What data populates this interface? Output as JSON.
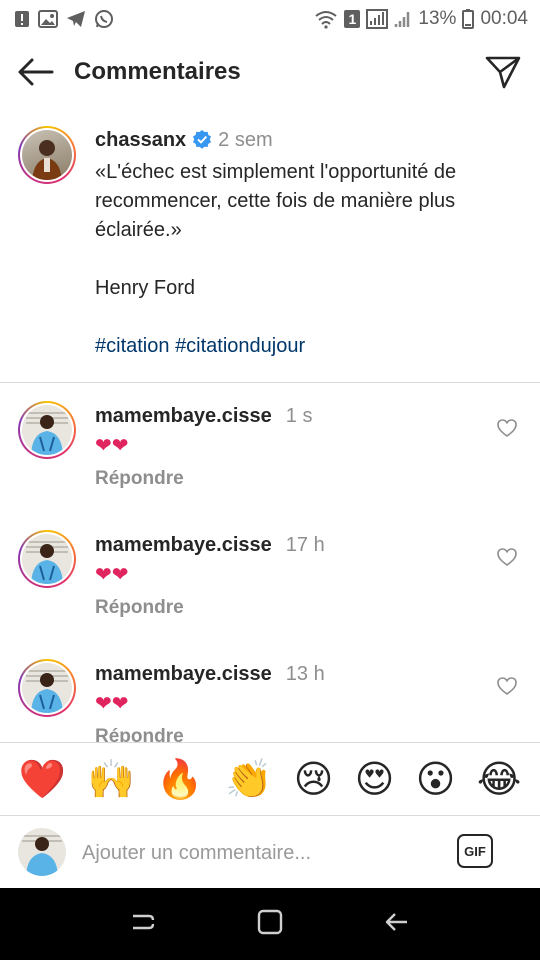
{
  "status_bar": {
    "battery": "13%",
    "time": "00:04",
    "sim_badge": "1"
  },
  "header": {
    "title": "Commentaires"
  },
  "caption": {
    "username": "chassanx",
    "time": "2 sem",
    "quote": "«L'échec est simplement l'opportunité de recommencer, cette fois de manière plus éclairée.»",
    "author": "Henry Ford",
    "hashtags": [
      "#citation",
      "#citationdujour"
    ]
  },
  "comments": [
    {
      "username": "mamembaye.cisse",
      "time": "1 s",
      "text": "❤❤",
      "reply": "Répondre"
    },
    {
      "username": "mamembaye.cisse",
      "time": "17 h",
      "text": "❤❤",
      "reply": "Répondre"
    },
    {
      "username": "mamembaye.cisse",
      "time": "13 h",
      "text": "❤❤",
      "reply": "Répondre"
    }
  ],
  "emoji_bar": [
    "❤️",
    "🙌",
    "🔥",
    "👏",
    "😢",
    "😍",
    "😮",
    "😂"
  ],
  "input": {
    "placeholder": "Ajouter un commentaire...",
    "gif_label": "GIF"
  },
  "colors": {
    "hashtag": "#00376b",
    "verified": "#3897f0",
    "heart": "#e0245e",
    "secondary_text": "#8e8e8e"
  }
}
